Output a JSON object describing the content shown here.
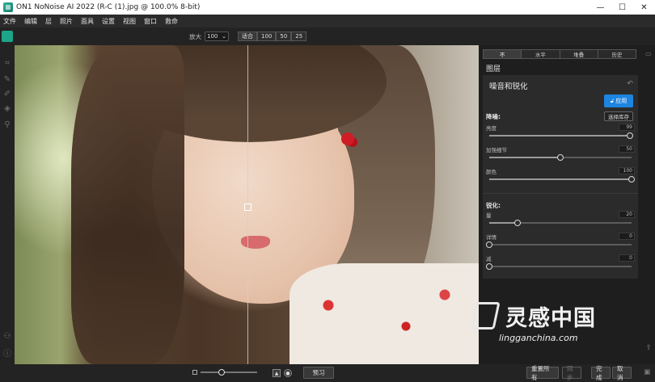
{
  "window": {
    "title": "ON1 NoNoise AI 2022 (R-C (1).jpg @ 100.0% 8-bit)",
    "controls": [
      "—",
      "☐",
      "✕"
    ]
  },
  "menu": [
    "文件",
    "编辑",
    "层",
    "照片",
    "面具",
    "设置",
    "视图",
    "窗口",
    "救命"
  ],
  "toolbar": {
    "zoom_label": "放大",
    "zoom_value": "100",
    "presets": [
      "适合",
      "100",
      "50",
      "25"
    ]
  },
  "panel": {
    "tabs": [
      "不",
      "水平",
      "堆叠",
      "历史"
    ],
    "layers_title": "图层",
    "section_title": "噪音和锐化",
    "apply_label": "应用",
    "denoise": {
      "title": "降噪:",
      "button": "选择库存",
      "sliders": [
        {
          "label": "亮度",
          "value": "99",
          "level": 0.99
        },
        {
          "label": "加强细节",
          "value": "50",
          "level": 0.5
        },
        {
          "label": "颜色",
          "value": "100",
          "level": 1.0
        }
      ]
    },
    "sharpen": {
      "title": "锐化:",
      "sliders": [
        {
          "label": "量",
          "value": "20",
          "level": 0.2
        },
        {
          "label": "详情",
          "value": "0",
          "level": 0.0
        },
        {
          "label": "减",
          "value": "0",
          "level": 0.0
        }
      ]
    }
  },
  "bottom": {
    "preview_label": "预习",
    "reset_all_label": "重置所有",
    "sync_label": "同步",
    "done_label": "完成",
    "cancel_label": "取消"
  },
  "watermark": {
    "cn": "灵感中国",
    "en": "lingganchina.com"
  },
  "colors": {
    "accent": "#1d84e0",
    "app_green": "#1ca58a"
  }
}
